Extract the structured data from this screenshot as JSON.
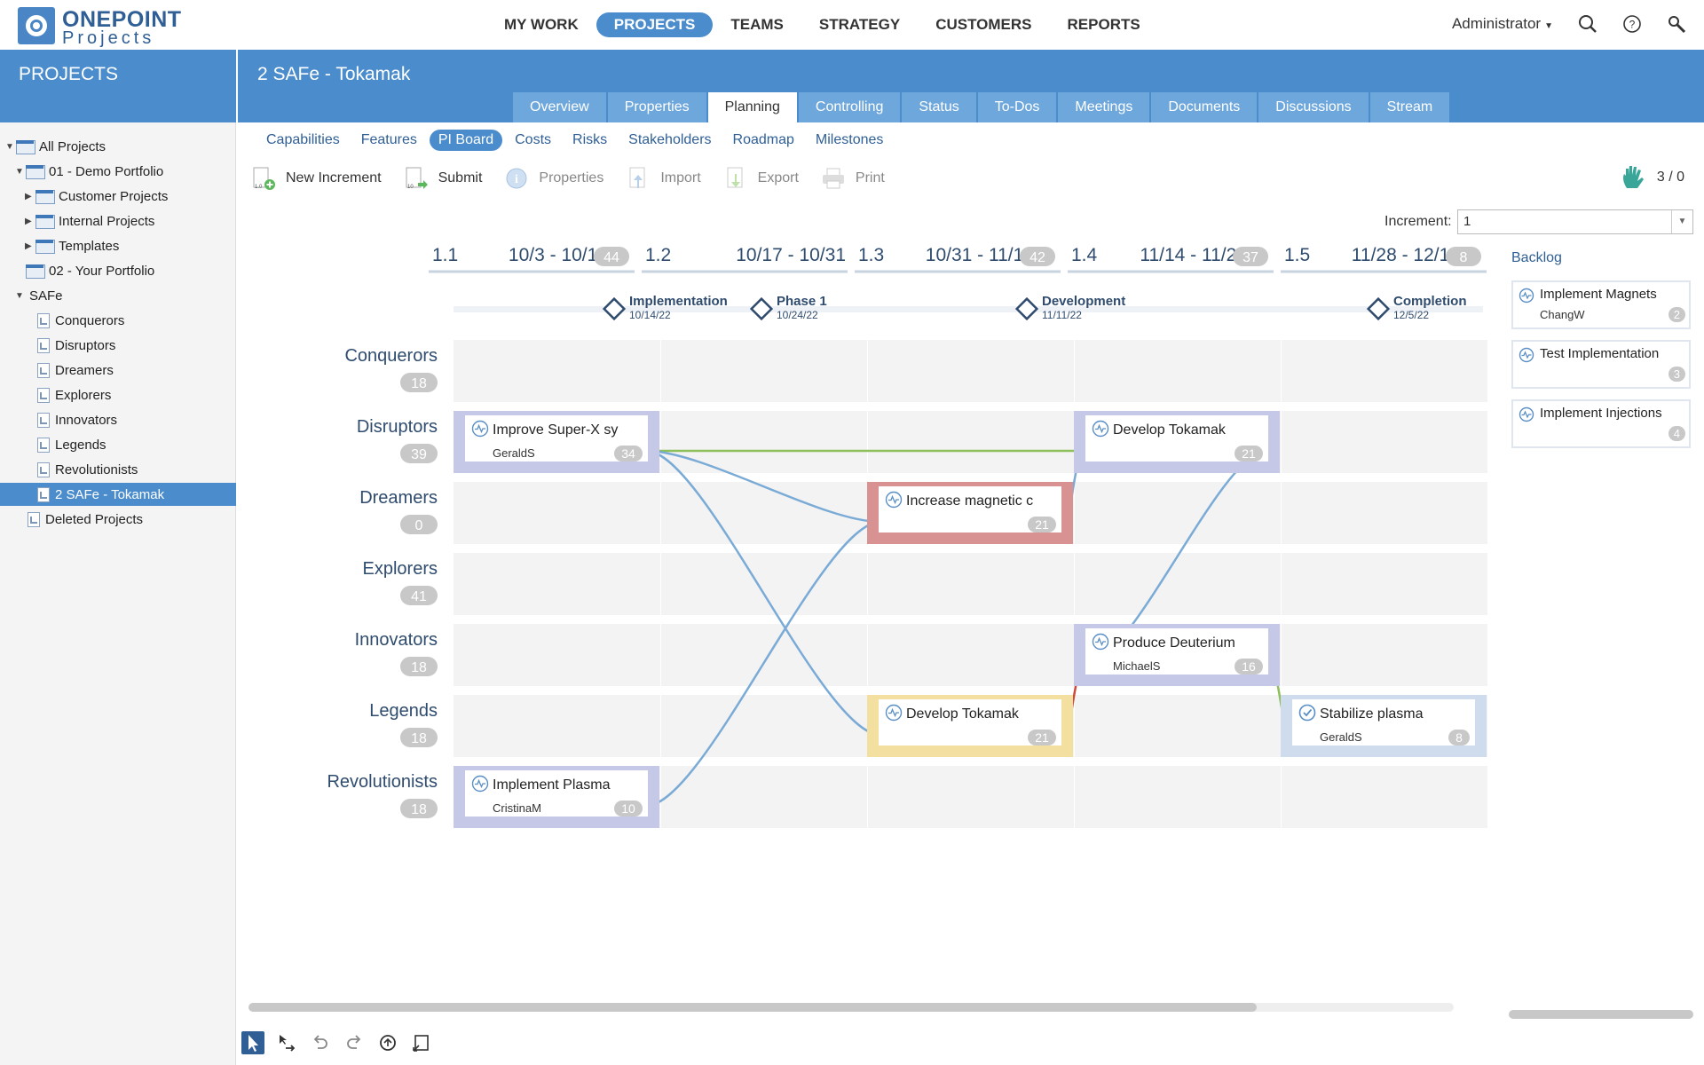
{
  "brand": {
    "line1": "ONEPOINT",
    "line2": "Projects"
  },
  "main_nav": [
    {
      "label": "MY WORK",
      "active": false
    },
    {
      "label": "PROJECTS",
      "active": true
    },
    {
      "label": "TEAMS",
      "active": false
    },
    {
      "label": "STRATEGY",
      "active": false
    },
    {
      "label": "CUSTOMERS",
      "active": false
    },
    {
      "label": "REPORTS",
      "active": false
    }
  ],
  "user": {
    "name": "Administrator"
  },
  "sidebar": {
    "title": "PROJECTS",
    "tree": [
      {
        "label": "All Projects",
        "level": 0,
        "arrow": "▼",
        "kind": "folder"
      },
      {
        "label": "01 - Demo Portfolio",
        "level": 1,
        "arrow": "▼",
        "kind": "folder"
      },
      {
        "label": "Customer Projects",
        "level": 2,
        "arrow": "▶",
        "kind": "folder"
      },
      {
        "label": "Internal Projects",
        "level": 2,
        "arrow": "▶",
        "kind": "folder"
      },
      {
        "label": "Templates",
        "level": 2,
        "arrow": "▶",
        "kind": "folder"
      },
      {
        "label": "02 - Your Portfolio",
        "level": 1,
        "arrow": "",
        "kind": "folder"
      },
      {
        "label": "SAFe",
        "level": 1,
        "arrow": "▼",
        "kind": "none"
      },
      {
        "label": "Conquerors",
        "level": 2,
        "arrow": "",
        "kind": "project"
      },
      {
        "label": "Disruptors",
        "level": 2,
        "arrow": "",
        "kind": "project"
      },
      {
        "label": "Dreamers",
        "level": 2,
        "arrow": "",
        "kind": "project"
      },
      {
        "label": "Explorers",
        "level": 2,
        "arrow": "",
        "kind": "project"
      },
      {
        "label": "Innovators",
        "level": 2,
        "arrow": "",
        "kind": "project"
      },
      {
        "label": "Legends",
        "level": 2,
        "arrow": "",
        "kind": "project"
      },
      {
        "label": "Revolutionists",
        "level": 2,
        "arrow": "",
        "kind": "project"
      },
      {
        "label": "2 SAFe - Tokamak",
        "level": 2,
        "arrow": "",
        "kind": "project",
        "selected": true
      },
      {
        "label": "Deleted Projects",
        "level": 1,
        "arrow": "",
        "kind": "project"
      }
    ]
  },
  "project": {
    "title": "2 SAFe - Tokamak",
    "tabs": [
      {
        "label": "Overview",
        "active": false
      },
      {
        "label": "Properties",
        "active": false
      },
      {
        "label": "Planning",
        "active": true
      },
      {
        "label": "Controlling",
        "active": false
      },
      {
        "label": "Status",
        "active": false
      },
      {
        "label": "To-Dos",
        "active": false
      },
      {
        "label": "Meetings",
        "active": false
      },
      {
        "label": "Documents",
        "active": false
      },
      {
        "label": "Discussions",
        "active": false
      },
      {
        "label": "Stream",
        "active": false
      }
    ],
    "subtabs": [
      {
        "label": "Capabilities",
        "active": false
      },
      {
        "label": "Features",
        "active": false
      },
      {
        "label": "PI Board",
        "active": true
      },
      {
        "label": "Costs",
        "active": false
      },
      {
        "label": "Risks",
        "active": false
      },
      {
        "label": "Stakeholders",
        "active": false
      },
      {
        "label": "Roadmap",
        "active": false
      },
      {
        "label": "Milestones",
        "active": false
      }
    ]
  },
  "toolbar": {
    "new_increment": "New Increment",
    "submit": "Submit",
    "properties": "Properties",
    "import": "Import",
    "export": "Export",
    "print": "Print",
    "counter": "3 / 0"
  },
  "increment_selector": {
    "label": "Increment:",
    "value": "1"
  },
  "board": {
    "sprints": [
      {
        "id": "1.1",
        "dates": "10/3 - 10/17",
        "count": "44"
      },
      {
        "id": "1.2",
        "dates": "10/17 - 10/31",
        "count": ""
      },
      {
        "id": "1.3",
        "dates": "10/31 - 11/14",
        "count": "42"
      },
      {
        "id": "1.4",
        "dates": "11/14 - 11/28",
        "count": "37"
      },
      {
        "id": "1.5",
        "dates": "11/28 - 12/12",
        "count": "8"
      }
    ],
    "milestones": [
      {
        "name": "Implementation",
        "date": "10/14/22"
      },
      {
        "name": "Phase 1",
        "date": "10/24/22"
      },
      {
        "name": "Development",
        "date": "11/11/22"
      },
      {
        "name": "Completion",
        "date": "12/5/22"
      }
    ],
    "teams": [
      {
        "name": "Conquerors",
        "count": "18"
      },
      {
        "name": "Disruptors",
        "count": "39"
      },
      {
        "name": "Dreamers",
        "count": "0"
      },
      {
        "name": "Explorers",
        "count": "41"
      },
      {
        "name": "Innovators",
        "count": "18"
      },
      {
        "name": "Legends",
        "count": "18"
      },
      {
        "name": "Revolutionists",
        "count": "18"
      }
    ],
    "cards": [
      {
        "title": "Improve Super-X sy",
        "owner": "GeraldS",
        "points": "34",
        "team": 1,
        "sprint": 0,
        "border": "#c5c8e6",
        "icon": "feature"
      },
      {
        "title": "Develop Tokamak",
        "owner": "",
        "points": "21",
        "team": 1,
        "sprint": 3,
        "border": "#c5c8e6",
        "icon": "feature"
      },
      {
        "title": "Increase magnetic c",
        "owner": "",
        "points": "21",
        "team": 2,
        "sprint": 2,
        "border": "#d89292",
        "icon": "feature"
      },
      {
        "title": "Produce Deuterium",
        "owner": "MichaelS",
        "points": "16",
        "team": 4,
        "sprint": 3,
        "border": "#c5c8e6",
        "icon": "feature"
      },
      {
        "title": "Develop Tokamak",
        "owner": "",
        "points": "21",
        "team": 5,
        "sprint": 2,
        "border": "#f3dfa0",
        "icon": "feature"
      },
      {
        "title": "Stabilize plasma",
        "owner": "GeraldS",
        "points": "8",
        "team": 5,
        "sprint": 4,
        "border": "#cfdcee",
        "icon": "done"
      },
      {
        "title": "Implement Plasma",
        "owner": "CristinaM",
        "points": "10",
        "team": 6,
        "sprint": 0,
        "border": "#c5c8e6",
        "icon": "feature"
      }
    ],
    "links": [
      {
        "from": 0,
        "to": 1,
        "color": "#8dbf5a"
      },
      {
        "from": 0,
        "to": 2,
        "color": "#7aaad6"
      },
      {
        "from": 0,
        "to": 4,
        "color": "#7aaad6"
      },
      {
        "from": 2,
        "to": 1,
        "color": "#7aaad6"
      },
      {
        "from": 6,
        "to": 2,
        "color": "#7aaad6"
      },
      {
        "from": 3,
        "to": 1,
        "color": "#7aaad6"
      },
      {
        "from": 4,
        "to": 3,
        "color": "#d04a3a"
      },
      {
        "from": 3,
        "to": 5,
        "color": "#8dbf5a"
      }
    ]
  },
  "backlog": {
    "title": "Backlog",
    "items": [
      {
        "title": "Implement Magnets",
        "owner": "ChangW",
        "points": "2"
      },
      {
        "title": "Test Implementation",
        "owner": "",
        "points": "3"
      },
      {
        "title": "Implement Injections",
        "owner": "",
        "points": "4"
      }
    ]
  },
  "colors": {
    "brand": "#4a8ccc",
    "tab": "#6ea7dc",
    "link_blue": "#7aaad6",
    "link_green": "#8dbf5a",
    "link_red": "#d04a3a"
  }
}
